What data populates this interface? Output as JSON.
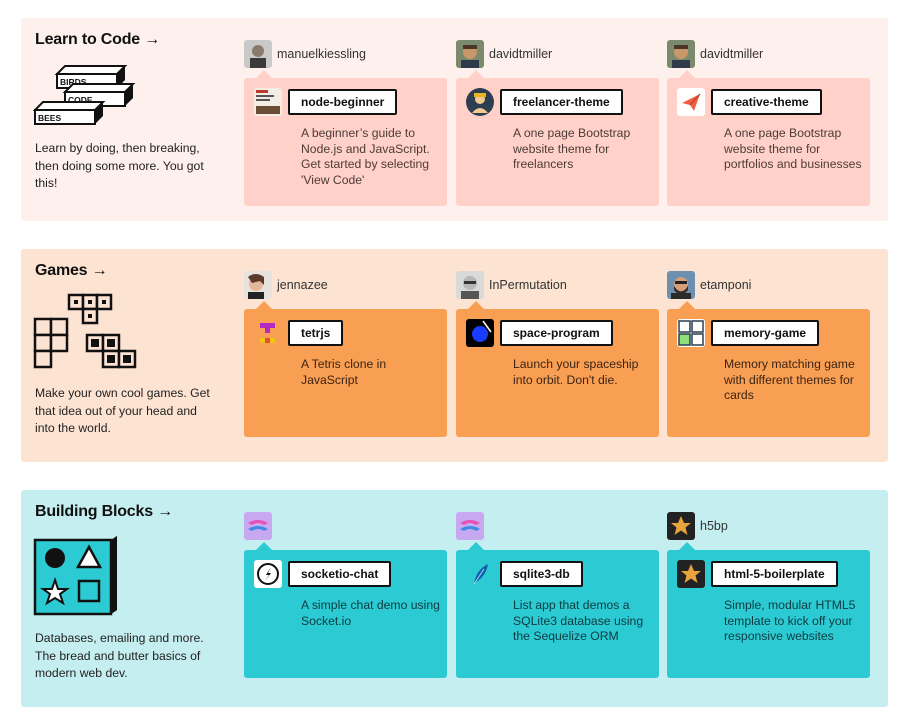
{
  "sections": [
    {
      "title": "Learn to Code →",
      "description": "Learn by doing, then breaking, then doing some more. You got this!",
      "illustration_words": [
        "BIRDS",
        "CODE",
        "BEES"
      ],
      "repos": [
        {
          "owner": "manuelkiessling",
          "name": "node-beginner",
          "description": "A beginner’s guide to Node.js and JavaScript. Get started by selecting 'View Code'",
          "icon": "book-cover-icon"
        },
        {
          "owner": "davidtmiller",
          "name": "freelancer-theme",
          "description": "A one page Bootstrap website theme for freelancers",
          "icon": "freelancer-avatar-icon"
        },
        {
          "owner": "davidtmiller",
          "name": "creative-theme",
          "description": "A one page Bootstrap website theme for portfolios and businesses",
          "icon": "paper-plane-icon"
        }
      ]
    },
    {
      "title": "Games →",
      "description": "Make your own cool games. Get that idea out of your head and into the world.",
      "repos": [
        {
          "owner": "jennazee",
          "name": "tetrjs",
          "description": "A Tetris clone in JavaScript",
          "icon": "tetris-icon"
        },
        {
          "owner": "InPermutation",
          "name": "space-program",
          "description": "Launch your spaceship into orbit. Don't die.",
          "icon": "planet-icon"
        },
        {
          "owner": "etamponi",
          "name": "memory-game",
          "description": "Memory matching game with different themes for cards",
          "icon": "memory-grid-icon"
        }
      ]
    },
    {
      "title": "Building Blocks →",
      "description": "Databases, emailing and more. The bread and butter basics of modern web dev.",
      "repos": [
        {
          "owner": "",
          "name": "socketio-chat",
          "description": "A simple chat demo using Socket.io",
          "icon": "socketio-icon"
        },
        {
          "owner": "",
          "name": "sqlite3-db",
          "description": "List app that demos a SQLite3 database using the Sequelize ORM",
          "icon": "sqlite-feather-icon"
        },
        {
          "owner": "h5bp",
          "name": "html-5-boilerplate",
          "description": "Simple, modular HTML5 template to kick off your responsive websites",
          "icon": "star-icon"
        }
      ]
    }
  ],
  "colors": {
    "learn_bg": "#fdf0ed",
    "learn_card": "#ffd1c8",
    "games_bg": "#fde3d2",
    "games_card": "#f99f53",
    "blocks_bg": "#c5eef0",
    "blocks_card": "#2ccad3"
  }
}
